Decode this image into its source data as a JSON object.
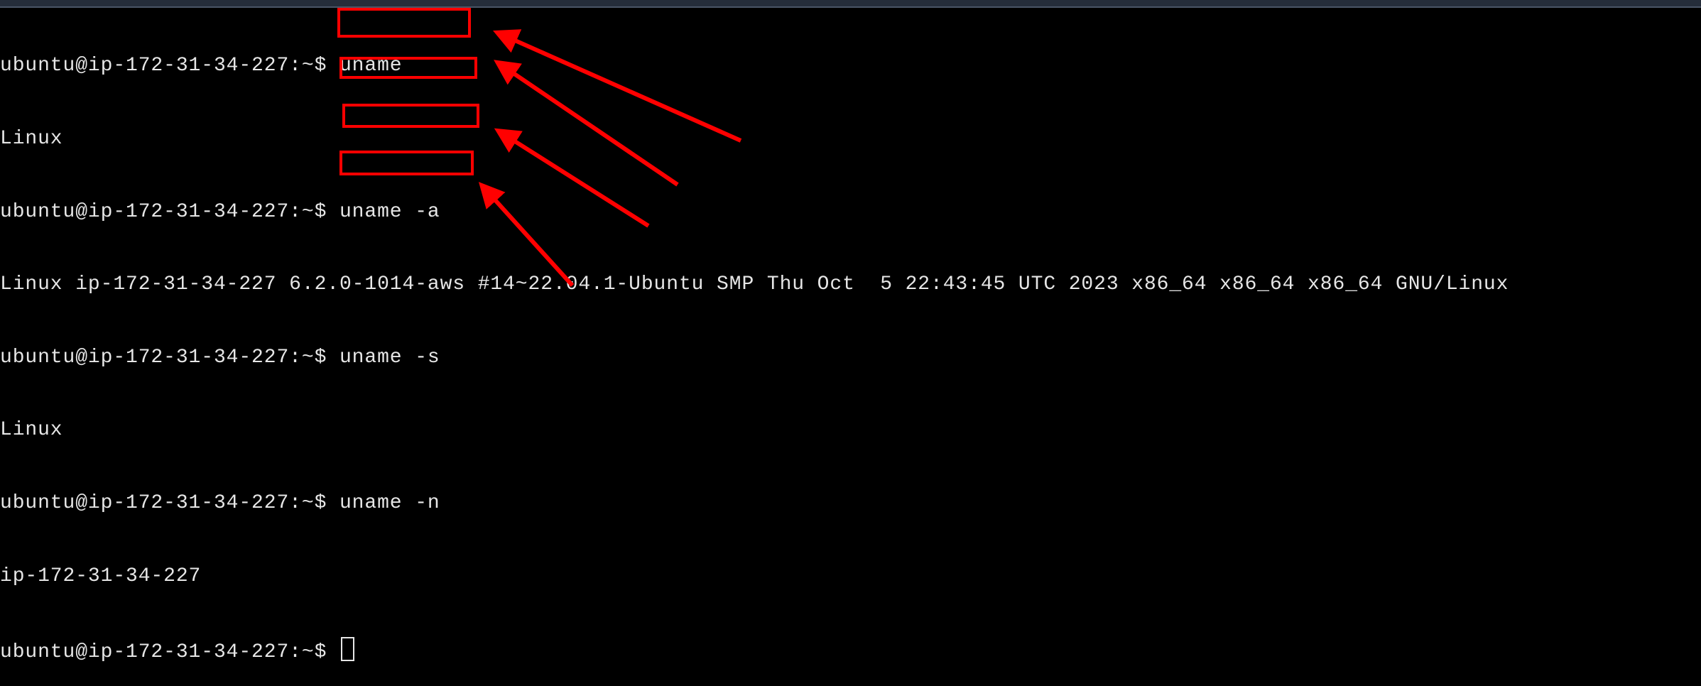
{
  "terminal": {
    "lines": [
      {
        "prompt": "ubuntu@ip-172-31-34-227:~$ ",
        "command": "uname"
      },
      {
        "output": "Linux"
      },
      {
        "prompt": "ubuntu@ip-172-31-34-227:~$ ",
        "command": "uname -a"
      },
      {
        "output": "Linux ip-172-31-34-227 6.2.0-1014-aws #14~22.04.1-Ubuntu SMP Thu Oct  5 22:43:45 UTC 2023 x86_64 x86_64 x86_64 GNU/Linux"
      },
      {
        "prompt": "ubuntu@ip-172-31-34-227:~$ ",
        "command": "uname -s"
      },
      {
        "output": "Linux"
      },
      {
        "prompt": "ubuntu@ip-172-31-34-227:~$ ",
        "command": "uname -n"
      },
      {
        "output": "ip-172-31-34-227"
      },
      {
        "prompt": "ubuntu@ip-172-31-34-227:~$ ",
        "command": ""
      }
    ]
  },
  "colors": {
    "annotation": "#ff0000",
    "text": "#e6e6e6",
    "background": "#000000"
  }
}
